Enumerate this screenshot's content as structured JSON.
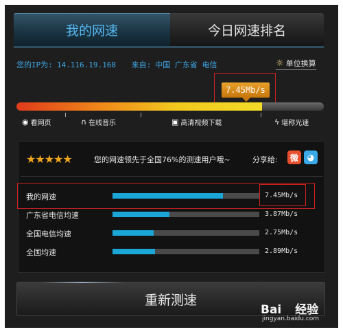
{
  "tabs": {
    "my_speed": "我的网速",
    "ranking": "今日网速排名"
  },
  "info": {
    "ip_label": "您的IP为:",
    "ip": "14.116.19.168",
    "from_label": "来自:",
    "location": "中国 广东省 电信"
  },
  "unit_convert": "单位换算",
  "bubble_speed": "7.45Mb/s",
  "speed_gauge": {
    "fill_fraction": 0.8
  },
  "milestones": [
    {
      "icon": "eye-icon",
      "label": "看网页"
    },
    {
      "icon": "headphones-icon",
      "label": "在线音乐"
    },
    {
      "icon": "video-icon",
      "label": "高清视频下载"
    },
    {
      "icon": "lightning-icon",
      "label": "堪称光速"
    }
  ],
  "rating": {
    "stars": "★★★★★",
    "text": "您的网速领先于全国76%的测速用户哦~",
    "share_label": "分享给:",
    "weibo_icon": "weibo-icon",
    "qq_icon": "qq-icon"
  },
  "rows": [
    {
      "label": "我的网速",
      "value": "7.45Mb/s",
      "fraction": 0.75
    },
    {
      "label": "广东省电信均速",
      "value": "3.87Mb/s",
      "fraction": 0.39
    },
    {
      "label": "全国电信均速",
      "value": "2.75Mb/s",
      "fraction": 0.28
    },
    {
      "label": "全国均速",
      "value": "2.89Mb/s",
      "fraction": 0.29
    }
  ],
  "retest_label": "重新测速",
  "watermark": {
    "brand": "Bai",
    "brand2": "经验",
    "url": "jingyan.baidu.com"
  },
  "colors": {
    "accent_blue": "#1aa6d6",
    "tab_active_text": "#56b7f0",
    "bubble": "#e9a12a",
    "highlight_box": "#cc2222"
  }
}
